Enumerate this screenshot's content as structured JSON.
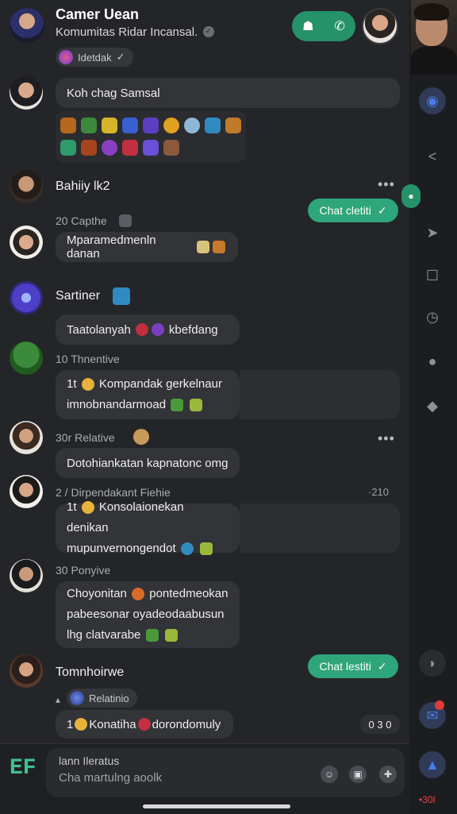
{
  "header": {
    "title": "Camer Uean",
    "subtitle": "Komumitas Ridar Incansal.",
    "pill_label": "Idetdak",
    "actions_icons": [
      "user-group-icon",
      "call-icon"
    ]
  },
  "messages": [
    {
      "bubble": "Koh chag Samsal"
    },
    {
      "name": "Bahiiy lk2",
      "chip": "Chat cletiti",
      "meta": "20 Capthe",
      "bubble": "Mparamedmenln danan"
    },
    {
      "name": "Sartiner",
      "bubble": "Taatolanyah",
      "bubble_after": "kbefdang",
      "meta": "10 Thnentive"
    },
    {
      "line1_prefix": "1t",
      "line1": "Kompandak gerkelnaur",
      "line2": "imnobnandarmoad"
    },
    {
      "meta": "30r Relative",
      "dots": "•••",
      "bubble": "Dotohiankatan kapnatonc omg"
    },
    {
      "meta": "2 / Dirpendakant Fiehie",
      "ts": "·210",
      "line1_prefix": "1t",
      "line1": "Konsolaionekan denikan",
      "line2": "mupunvernongendot"
    },
    {
      "meta": "30 Ponyive",
      "line1": "Choyonitan",
      "line1b": "pontedmeokan",
      "line2": "pabeesonar oyadeodaabusun",
      "line3": "lhg clatvarabe"
    },
    {
      "name": "Tomnhoirwe",
      "chip": "Chat lestiti",
      "pill": "Relatinio",
      "line1_prefix": "1",
      "line1": "Konatiha",
      "line1b": "dorondomuly",
      "ts": "0 3 0"
    }
  ],
  "composer": {
    "title": "lann Ileratus",
    "placeholder": "Cha martulng aoolk",
    "logo": "EF"
  },
  "right_rail": {
    "footer": "•30I"
  },
  "colors": {
    "accent": "#2ea57a",
    "background": "#242528",
    "bubble": "#333438"
  }
}
